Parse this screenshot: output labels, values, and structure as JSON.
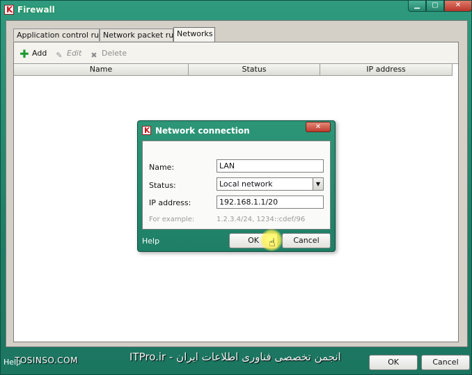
{
  "window": {
    "title": "Firewall",
    "controls": {
      "minimize": "▁",
      "maximize": "▢",
      "close": "✕"
    }
  },
  "tabs": [
    {
      "label": "Application control rules",
      "active": false
    },
    {
      "label": "Network packet rules",
      "active": false
    },
    {
      "label": "Networks",
      "active": true
    }
  ],
  "toolbar": {
    "add": {
      "label": "Add",
      "icon": "plus-icon",
      "enabled": true
    },
    "edit": {
      "label": "Edit",
      "icon": "pencil-icon",
      "enabled": false
    },
    "delete": {
      "label": "Delete",
      "icon": "delete-icon",
      "enabled": false
    }
  },
  "table": {
    "columns": [
      "Name",
      "Status",
      "IP address"
    ],
    "rows": []
  },
  "bottom": {
    "help": "Help",
    "ok": "OK",
    "cancel": "Cancel"
  },
  "watermarks": {
    "left": "TOSINSO.COM",
    "center": "ITPro.ir - انجمن تخصصی فناوری اطلاعات ایران"
  },
  "dialog": {
    "title": "Network connection",
    "close": "✕",
    "name_label": "Name:",
    "name_value": "LAN",
    "status_label": "Status:",
    "status_value": "Local network",
    "ip_label": "IP address:",
    "ip_value": "192.168.1.1/20",
    "example_label": "For example:",
    "example_value": "1.2.3.4/24, 1234::cdef/96",
    "help": "Help",
    "ok": "OK",
    "cancel": "Cancel"
  },
  "colors": {
    "frame": "#1f7f67",
    "client": "#d4d0c8",
    "close_button": "#bf3b2d",
    "brand_red": "#c4141a"
  }
}
